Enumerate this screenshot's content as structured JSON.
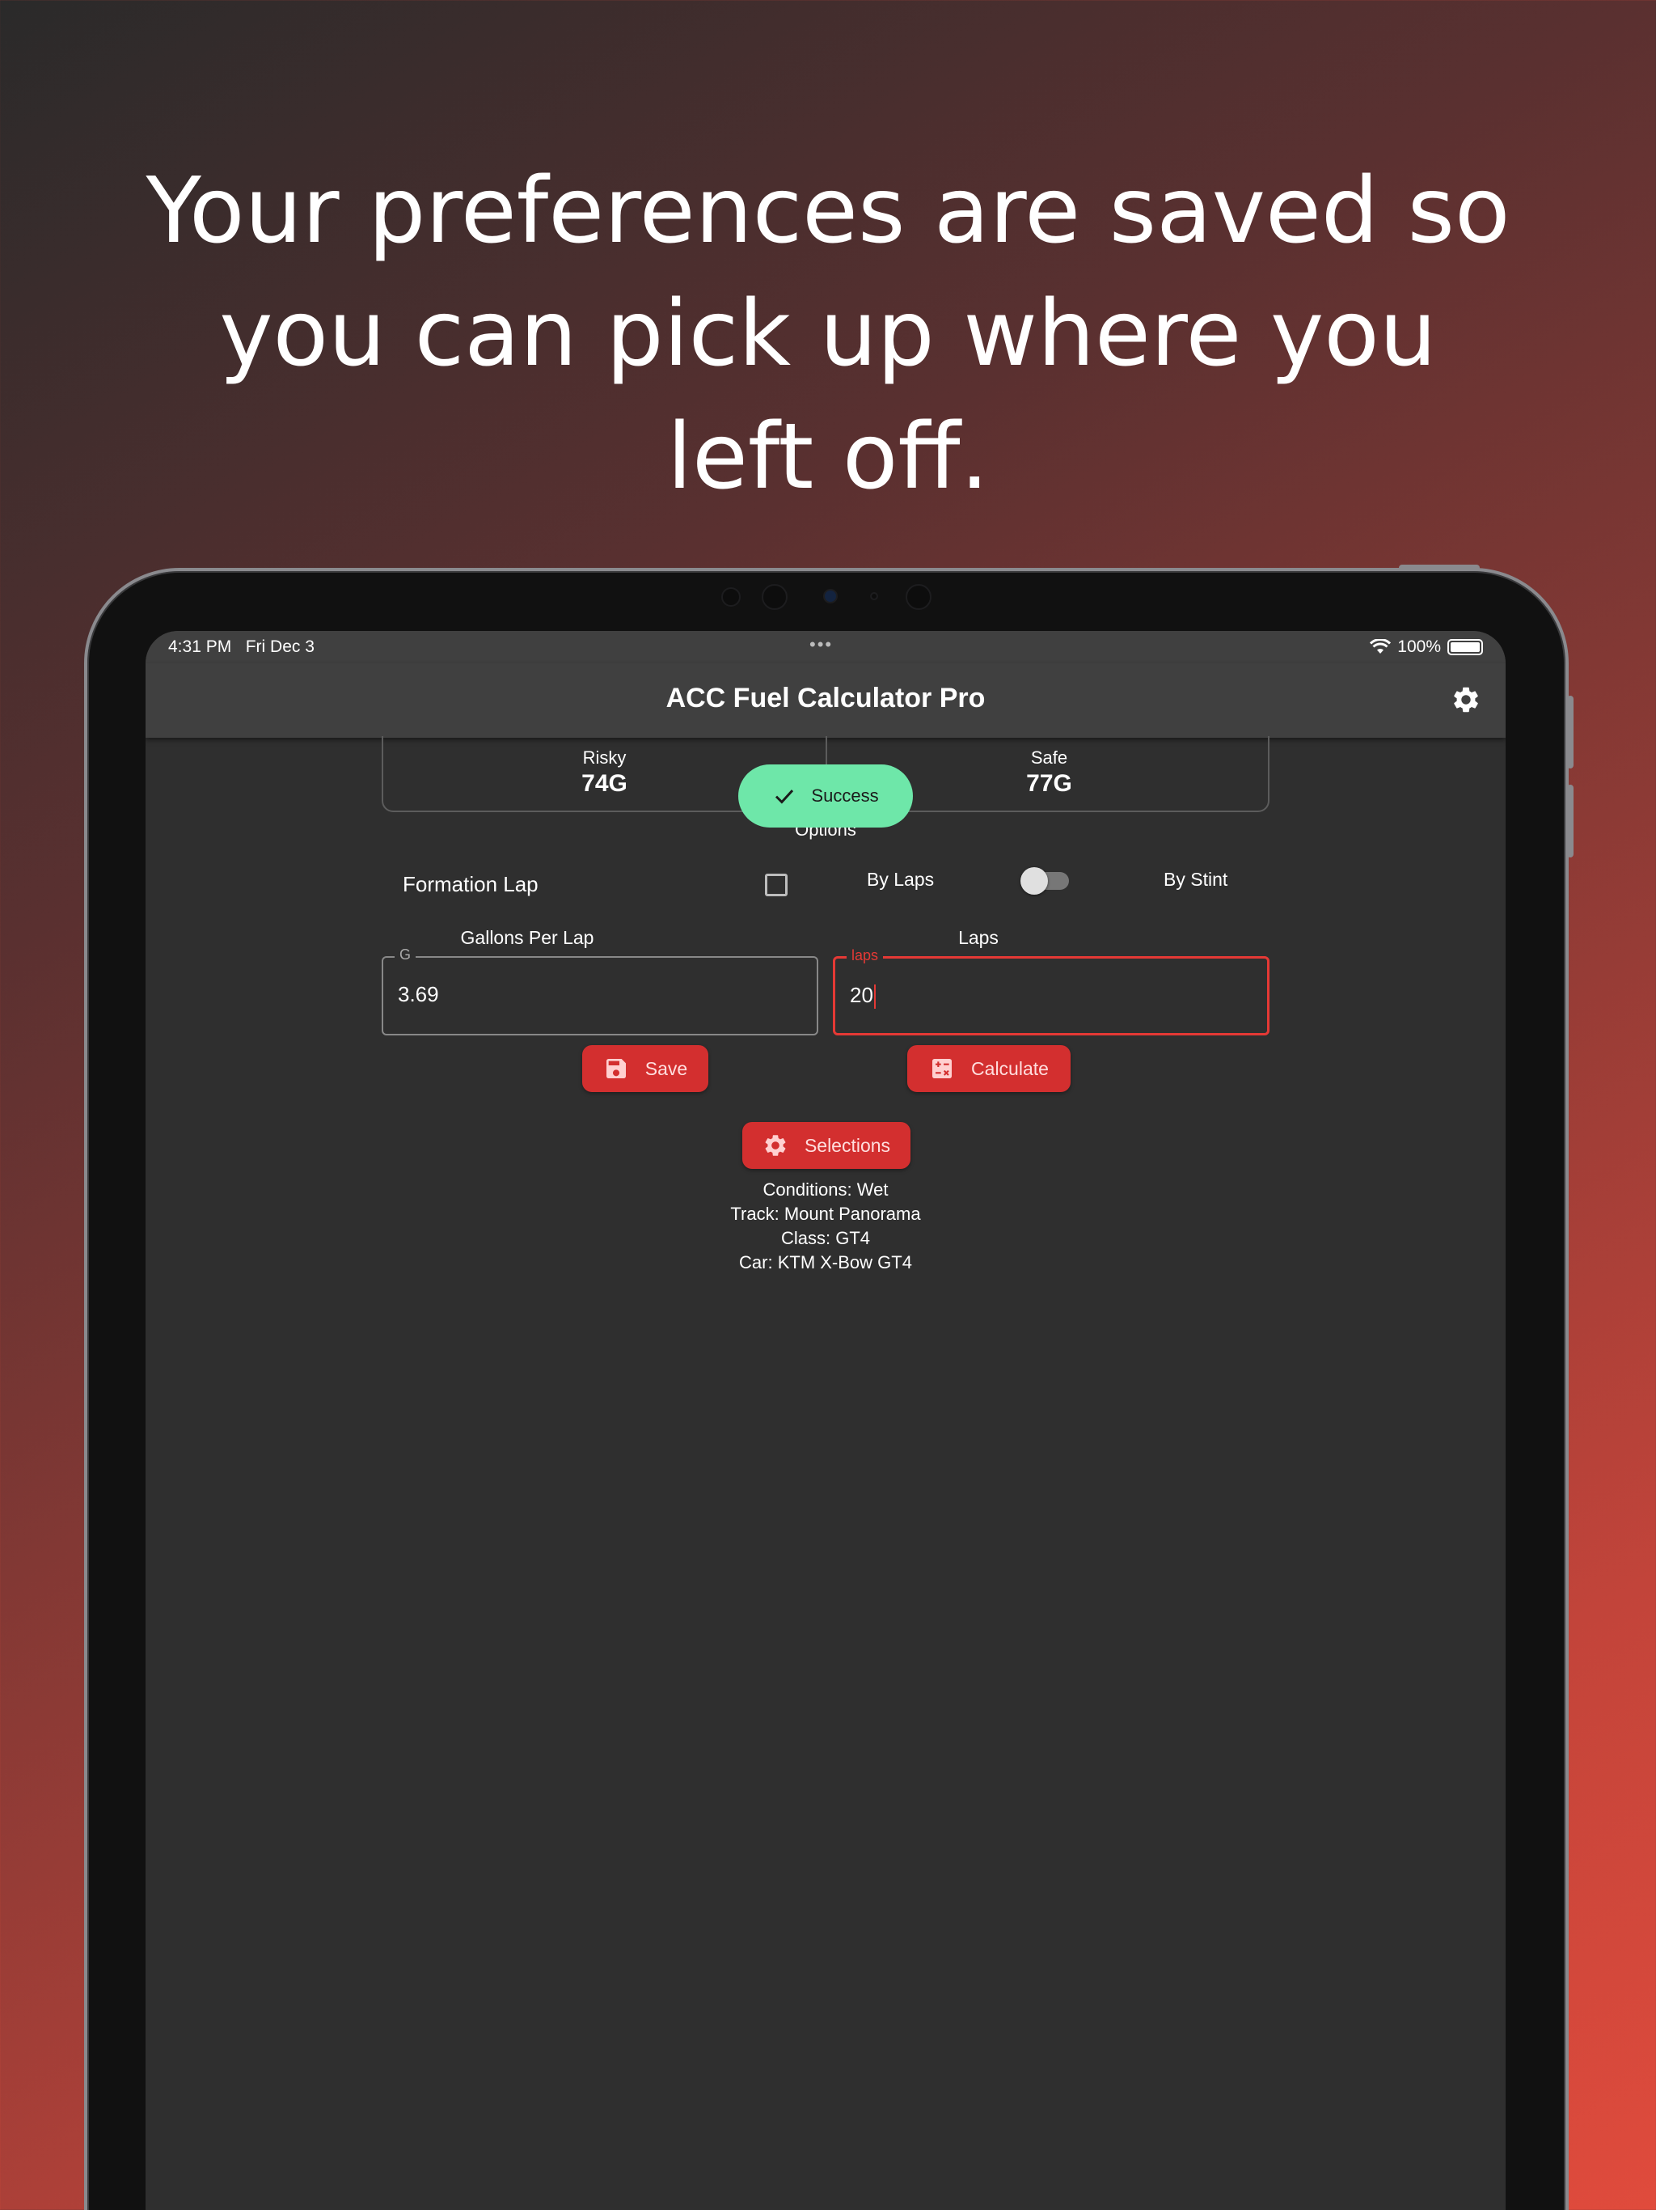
{
  "headline": "Your preferences are saved so you can pick up where you left off.",
  "status": {
    "time": "4:31 PM",
    "date": "Fri Dec 3",
    "dots": "•••",
    "battery": "100%"
  },
  "appbar": {
    "title": "ACC Fuel Calculator Pro",
    "settings_icon": "gear-icon"
  },
  "results": {
    "risky_label": "Risky",
    "risky_value": "74G",
    "safe_label": "Safe",
    "safe_value": "77G"
  },
  "toast": {
    "text": "Success",
    "icon": "check-icon",
    "color": "#6ee7a9"
  },
  "options": {
    "title": "Options",
    "formation_lap_label": "Formation Lap",
    "formation_lap_checked": false,
    "mode_left": "By Laps",
    "mode_right": "By Stint",
    "mode_toggle_on": false
  },
  "fields": {
    "gallons_caption": "Gallons Per Lap",
    "gallons_legend": "G",
    "gallons_value": "3.69",
    "laps_caption": "Laps",
    "laps_legend": "laps",
    "laps_value": "20"
  },
  "buttons": {
    "save": "Save",
    "save_icon": "floppy-disk-icon",
    "calculate": "Calculate",
    "calculate_icon": "calculator-icon",
    "selections": "Selections",
    "selections_icon": "gear-icon"
  },
  "info": {
    "conditions": "Conditions: Wet",
    "track": "Track: Mount Panorama",
    "class": "Class: GT4",
    "car": "Car: KTM X-Bow GT4"
  },
  "colors": {
    "accent": "#d32f2f",
    "error": "#e53935",
    "surface": "#2f2f2f",
    "appbar": "#404040"
  }
}
